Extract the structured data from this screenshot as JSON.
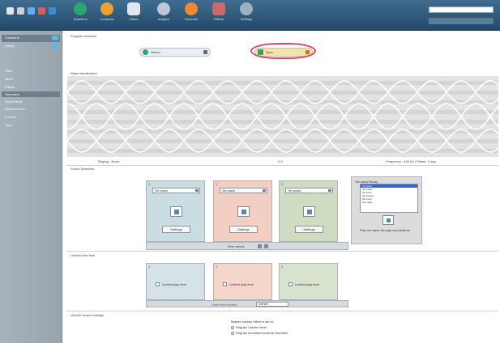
{
  "toolbar": {
    "buttons": [
      {
        "label": "Transform"
      },
      {
        "label": "Compose"
      },
      {
        "label": "Filters"
      },
      {
        "label": "Analyze"
      },
      {
        "label": "Generate"
      },
      {
        "label": "Effects"
      },
      {
        "label": "Settings"
      }
    ],
    "search_placeholder": "",
    "colors": {
      "bar_top": "#3f6d8f",
      "bar_bottom": "#23496a"
    }
  },
  "sidebar": {
    "items": [
      {
        "label": "Transform"
      },
      {
        "label": "Output"
      },
      {
        "label": "Filter"
      },
      {
        "label": "Mixer"
      },
      {
        "label": "Effects"
      },
      {
        "label": "Generator"
      },
      {
        "label": "Sound Bank"
      },
      {
        "label": "Advanced Mix"
      },
      {
        "label": "Preview"
      },
      {
        "label": "Save"
      }
    ]
  },
  "main": {
    "program": {
      "title": "Program selection",
      "mode_a": "Stereo",
      "mode_b": "Sync",
      "accent": "#d94b63"
    },
    "visualization": {
      "title": "Wave visualization",
      "left_caption": "Playing : None",
      "center_caption": "0  0",
      "right_caption": "Frequency : 440 Hz | Phase: 0 deg"
    },
    "sound_selection": {
      "title": "Sound Selection",
      "cards": [
        {
          "number": "1",
          "selected": "Sin wave",
          "button": "Settings",
          "color": "#c9dde3"
        },
        {
          "number": "2",
          "selected": "Sin wave",
          "button": "Settings",
          "color": "#f2cfc2"
        },
        {
          "number": "3",
          "selected": "Sin pulse",
          "button": "Settings",
          "color": "#cfdcc2"
        }
      ],
      "strip_label": "Sine waves",
      "list": {
        "title": "Sin wave library",
        "items": [
          "Sin wave",
          "Sin pulse",
          "Sin chirp",
          "Sin sweep",
          "Sin burst",
          "Sin noise"
        ],
        "selected_index": 0,
        "note": "Play sin wave through accelerators"
      }
    },
    "limits": {
      "title": "Limited sine time",
      "cards": [
        {
          "number": "1",
          "label": "Limited play time",
          "color": "#d5e2e6"
        },
        {
          "number": "2",
          "label": "Limited play time",
          "color": "#f5d6ca"
        },
        {
          "number": "3",
          "label": "Limited play time",
          "color": "#d8e3cd"
        }
      ],
      "strip_text": "Limit time equally:",
      "strip_select": "Infinite"
    },
    "volume": {
      "title": "Volume control settings",
      "options": [
        "Master volume effect is set to:",
        "Regular Volume level",
        "Regular increased level all channels"
      ]
    }
  }
}
